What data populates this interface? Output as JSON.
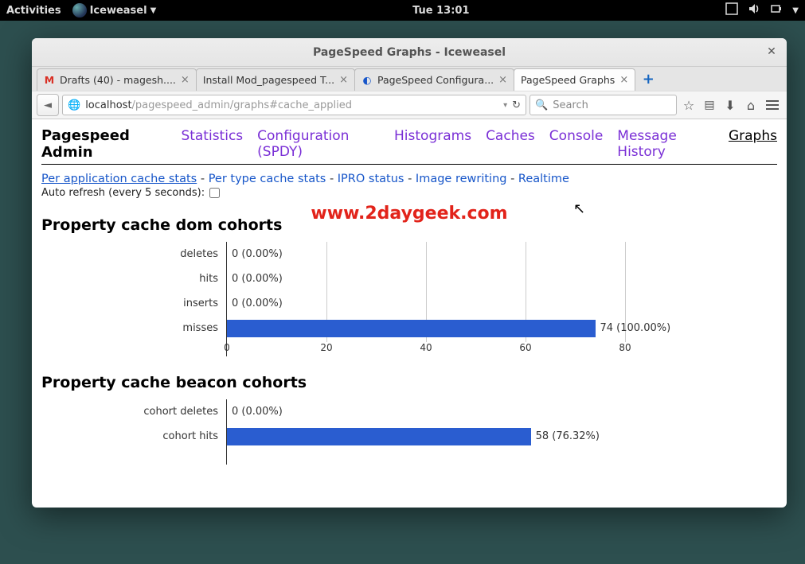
{
  "desktop": {
    "activities": "Activities",
    "app_menu": "Iceweasel",
    "clock": "Tue 13:01"
  },
  "window": {
    "title": "PageSpeed Graphs - Iceweasel"
  },
  "tabs": [
    {
      "label": "Drafts (40) - magesh....",
      "active": false,
      "icon": "gmail"
    },
    {
      "label": "Install Mod_pagespeed T...",
      "active": false,
      "icon": "generic"
    },
    {
      "label": "PageSpeed Configura...",
      "active": false,
      "icon": "pagespeed"
    },
    {
      "label": "PageSpeed Graphs",
      "active": true,
      "icon": "none"
    }
  ],
  "url": {
    "host": "localhost",
    "path": "/pagespeed_admin/graphs#cache_applied"
  },
  "search": {
    "placeholder": "Search"
  },
  "admin": {
    "title": "Pagespeed Admin",
    "links": [
      "Statistics",
      "Configuration (SPDY)",
      "Histograms",
      "Caches",
      "Console",
      "Message History",
      "Graphs"
    ],
    "current": "Graphs"
  },
  "subnav": {
    "links": [
      "Per application cache stats",
      "Per type cache stats",
      "IPRO status",
      "Image rewriting",
      "Realtime"
    ],
    "active": "Per application cache stats"
  },
  "autorefresh_label": "Auto refresh (every 5 seconds):",
  "watermark": "www.2daygeek.com",
  "chart_data": [
    {
      "type": "bar",
      "title": "Property cache dom cohorts",
      "orientation": "horizontal",
      "xlabel": "",
      "ylabel": "",
      "xlim": [
        0,
        80
      ],
      "xticks": [
        0,
        20,
        40,
        60,
        80
      ],
      "categories": [
        "deletes",
        "hits",
        "inserts",
        "misses"
      ],
      "values": [
        0,
        0,
        0,
        74
      ],
      "percents": [
        "0.00%",
        "0.00%",
        "0.00%",
        "100.00%"
      ]
    },
    {
      "type": "bar",
      "title": "Property cache beacon cohorts",
      "orientation": "horizontal",
      "xlabel": "",
      "ylabel": "",
      "xlim": [
        0,
        76
      ],
      "xticks": [],
      "categories": [
        "cohort deletes",
        "cohort hits"
      ],
      "values": [
        0,
        58
      ],
      "percents": [
        "0.00%",
        "76.32%"
      ]
    }
  ]
}
